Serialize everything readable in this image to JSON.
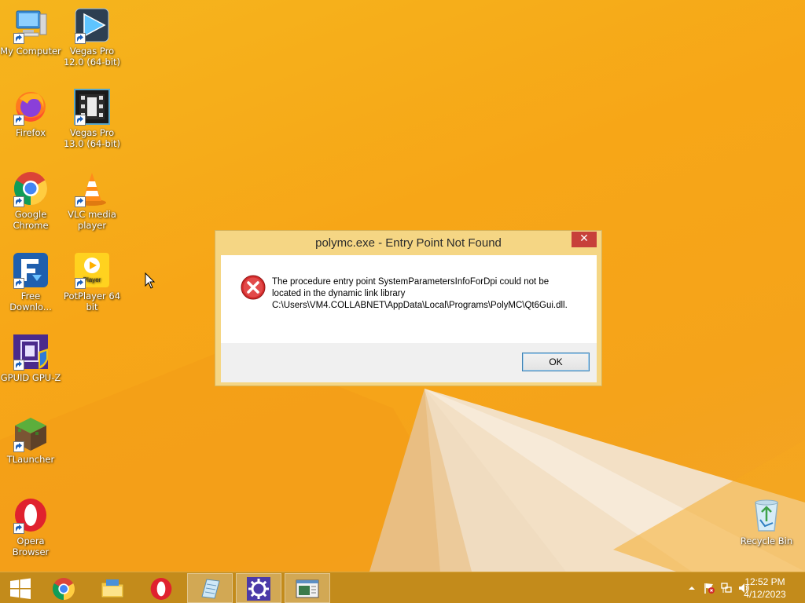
{
  "desktop": {
    "icons": [
      {
        "label": "My Computer",
        "icon": "computer-icon"
      },
      {
        "label": "Vegas Pro 12.0 (64-bit)",
        "icon": "vegas-pro-icon"
      },
      {
        "label": "Firefox",
        "icon": "firefox-icon"
      },
      {
        "label": "Vegas Pro 13.0 (64-bit)",
        "icon": "vegas-pro-13-icon"
      },
      {
        "label": "Google Chrome",
        "icon": "chrome-icon"
      },
      {
        "label": "VLC media player",
        "icon": "vlc-icon"
      },
      {
        "label": "Free Downlo...",
        "icon": "free-download-manager-icon"
      },
      {
        "label": "PotPlayer 64 bit",
        "icon": "potplayer-icon"
      },
      {
        "label": "GPUID GPU-Z",
        "icon": "gpuz-icon"
      },
      {
        "label": "TLauncher",
        "icon": "tlauncher-icon"
      },
      {
        "label": "Opera Browser",
        "icon": "opera-icon"
      },
      {
        "label": "Recycle Bin",
        "icon": "recycle-bin-icon"
      }
    ]
  },
  "dialog": {
    "title": "polymc.exe - Entry Point Not Found",
    "close_label": "✕",
    "message": "The procedure entry point SystemParametersInfoForDpi could not be located in the dynamic link library C:\\Users\\VM4.COLLABNET\\AppData\\Local\\Programs\\PolyMC\\Qt6Gui.dll.",
    "ok_label": "OK"
  },
  "taskbar": {
    "items": [
      {
        "name": "start-button",
        "icon": "windows-icon"
      },
      {
        "name": "chrome",
        "icon": "chrome-icon"
      },
      {
        "name": "file-explorer",
        "icon": "folder-icon"
      },
      {
        "name": "opera",
        "icon": "opera-icon"
      },
      {
        "name": "notepad-app",
        "icon": "notepad-icon"
      },
      {
        "name": "settings-app",
        "icon": "gear-icon"
      },
      {
        "name": "dialog-window",
        "icon": "window-icon"
      }
    ],
    "clock": {
      "time": "12:52 PM",
      "date": "4/12/2023"
    }
  },
  "colors": {
    "wallpaper": "#f7a617",
    "taskbar": "#c38b1b",
    "dialog_frame": "#f5d684",
    "close_button": "#c7403a",
    "error_red": "#d42b2b"
  }
}
